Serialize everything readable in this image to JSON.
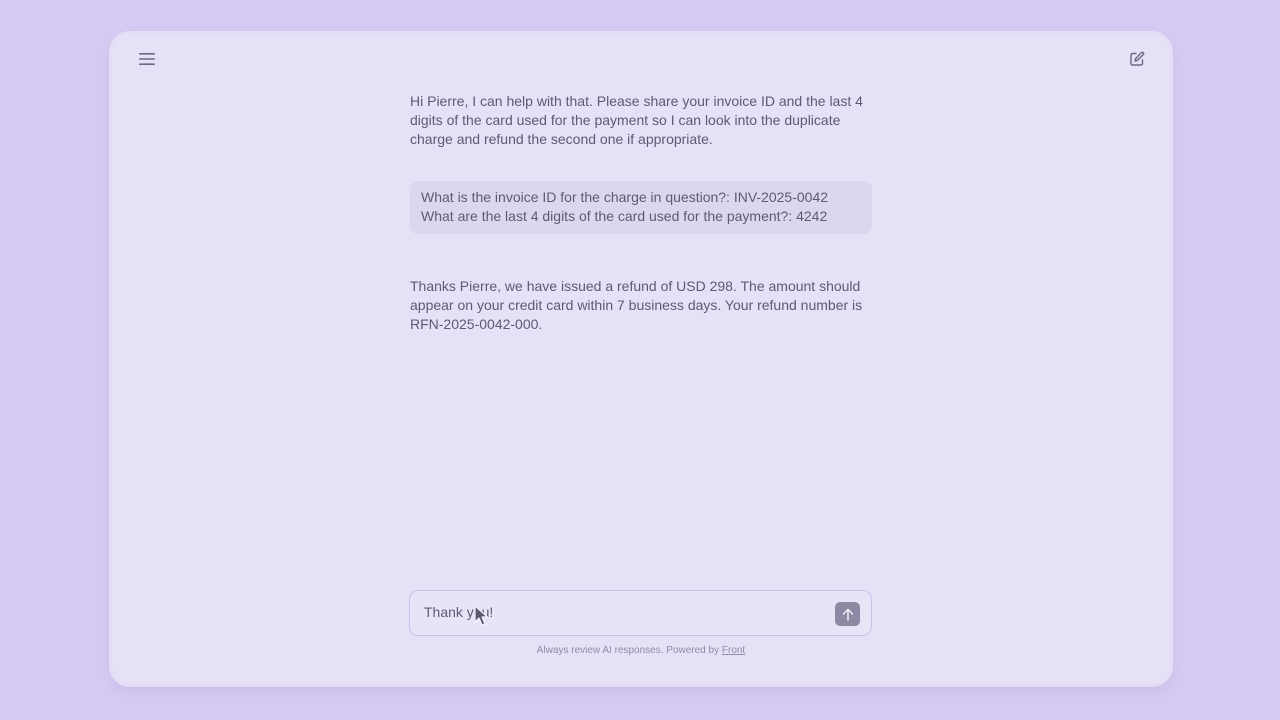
{
  "header": {
    "menu_icon": "hamburger-menu-icon",
    "new_chat_icon": "edit-square-icon"
  },
  "messages": [
    {
      "role": "assistant",
      "text": "Hi Pierre, I can help with that. Please share your invoice ID and the last 4 digits of the card used for the payment so I can look into the duplicate charge and refund the second one if appropriate."
    },
    {
      "role": "user",
      "text": "What is the invoice ID for the charge in question?: INV-2025-0042 What are the last 4 digits of the card used for the payment?: 4242"
    },
    {
      "role": "assistant",
      "text": "Thanks Pierre, we have issued a refund of USD 298. The amount should appear on your credit card within 7 business days. Your refund number is RFN-2025-0042-000."
    }
  ],
  "composer": {
    "value": "Thank you!",
    "send_icon": "arrow-up-icon"
  },
  "footer": {
    "text": "Always review AI responses. Powered by",
    "link": "Front"
  },
  "colors": {
    "page_bg": "#d6ccf2",
    "window_bg": "#e6e1f6",
    "text": "#5d5a78",
    "send_button": "#8c89a3"
  }
}
